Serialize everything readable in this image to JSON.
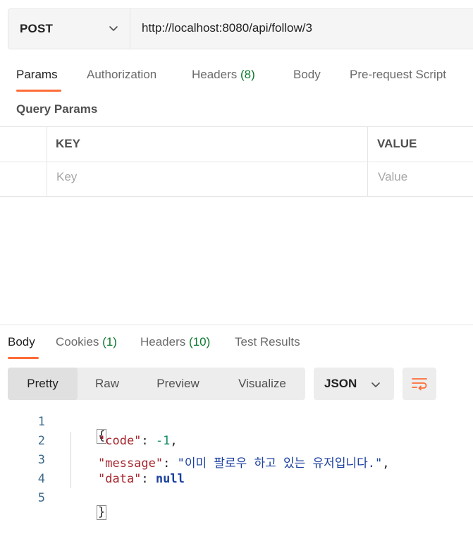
{
  "request": {
    "method": "POST",
    "url": "http://localhost:8080/api/follow/3"
  },
  "request_tabs": [
    {
      "label": "Params",
      "count": ""
    },
    {
      "label": "Authorization",
      "count": ""
    },
    {
      "label": "Headers",
      "count": "(8)"
    },
    {
      "label": "Body",
      "count": ""
    },
    {
      "label": "Pre-request Script",
      "count": ""
    }
  ],
  "query_params": {
    "title": "Query Params",
    "columns": [
      "KEY",
      "VALUE"
    ],
    "placeholders": {
      "key": "Key",
      "value": "Value"
    }
  },
  "response_tabs": [
    {
      "label": "Body",
      "count": ""
    },
    {
      "label": "Cookies",
      "count": "(1)"
    },
    {
      "label": "Headers",
      "count": "(10)"
    },
    {
      "label": "Test Results",
      "count": ""
    }
  ],
  "view_modes": [
    "Pretty",
    "Raw",
    "Preview",
    "Visualize"
  ],
  "format": "JSON",
  "code": {
    "line_numbers": [
      "1",
      "2",
      "3",
      "4",
      "5"
    ],
    "open_brace": "{",
    "close_brace": "}",
    "fields": [
      {
        "key": "\"code\"",
        "value": "-1",
        "type": "num",
        "trailing": ","
      },
      {
        "key": "\"message\"",
        "value": "\"이미 팔로우 하고 있는 유저입니다.\"",
        "type": "str",
        "trailing": ","
      },
      {
        "key": "\"data\"",
        "value": "null",
        "type": "null",
        "trailing": ""
      }
    ]
  },
  "colors": {
    "accent": "#ff6c37",
    "count_green": "#0c7a2f",
    "json_key": "#a6262d",
    "json_number": "#0a8c5d",
    "json_string": "#1a3f9e"
  }
}
